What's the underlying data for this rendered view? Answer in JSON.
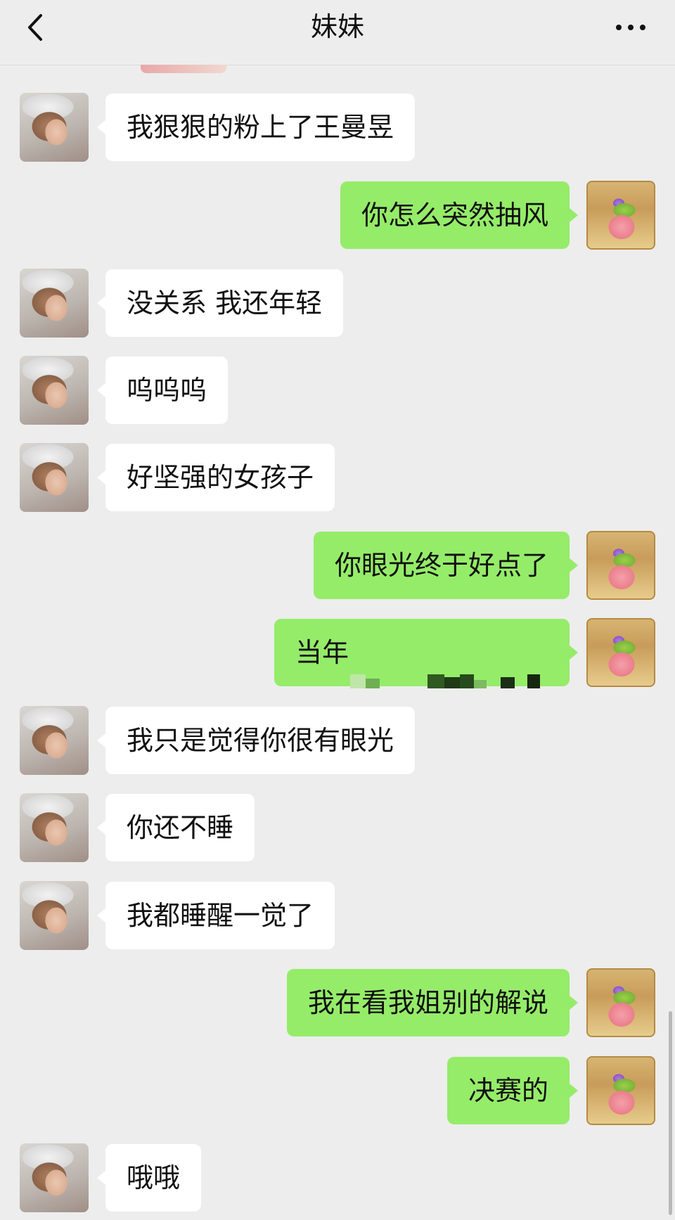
{
  "header": {
    "title": "妹妹",
    "back_icon": "chevron-left-icon",
    "more_icon": "more-dots-icon"
  },
  "messages": [
    {
      "side": "left",
      "text": "我狠狠的粉上了王曼昱"
    },
    {
      "side": "right",
      "text": "你怎么突然抽风"
    },
    {
      "side": "left",
      "text": "没关系 我还年轻"
    },
    {
      "side": "left",
      "text": "呜呜呜"
    },
    {
      "side": "left",
      "text": "好坚强的女孩子"
    },
    {
      "side": "right",
      "text": "你眼光终于好点了"
    },
    {
      "side": "right",
      "text": "当年",
      "censored": true
    },
    {
      "side": "left",
      "text": "我只是觉得你很有眼光"
    },
    {
      "side": "left",
      "text": "你还不睡"
    },
    {
      "side": "left",
      "text": "我都睡醒一觉了"
    },
    {
      "side": "right",
      "text": "我在看我姐别的解说"
    },
    {
      "side": "right",
      "text": "决赛的"
    },
    {
      "side": "left",
      "text": "哦哦"
    }
  ],
  "colors": {
    "background": "#ededed",
    "bubble_self": "#95ec69",
    "bubble_other": "#ffffff"
  }
}
